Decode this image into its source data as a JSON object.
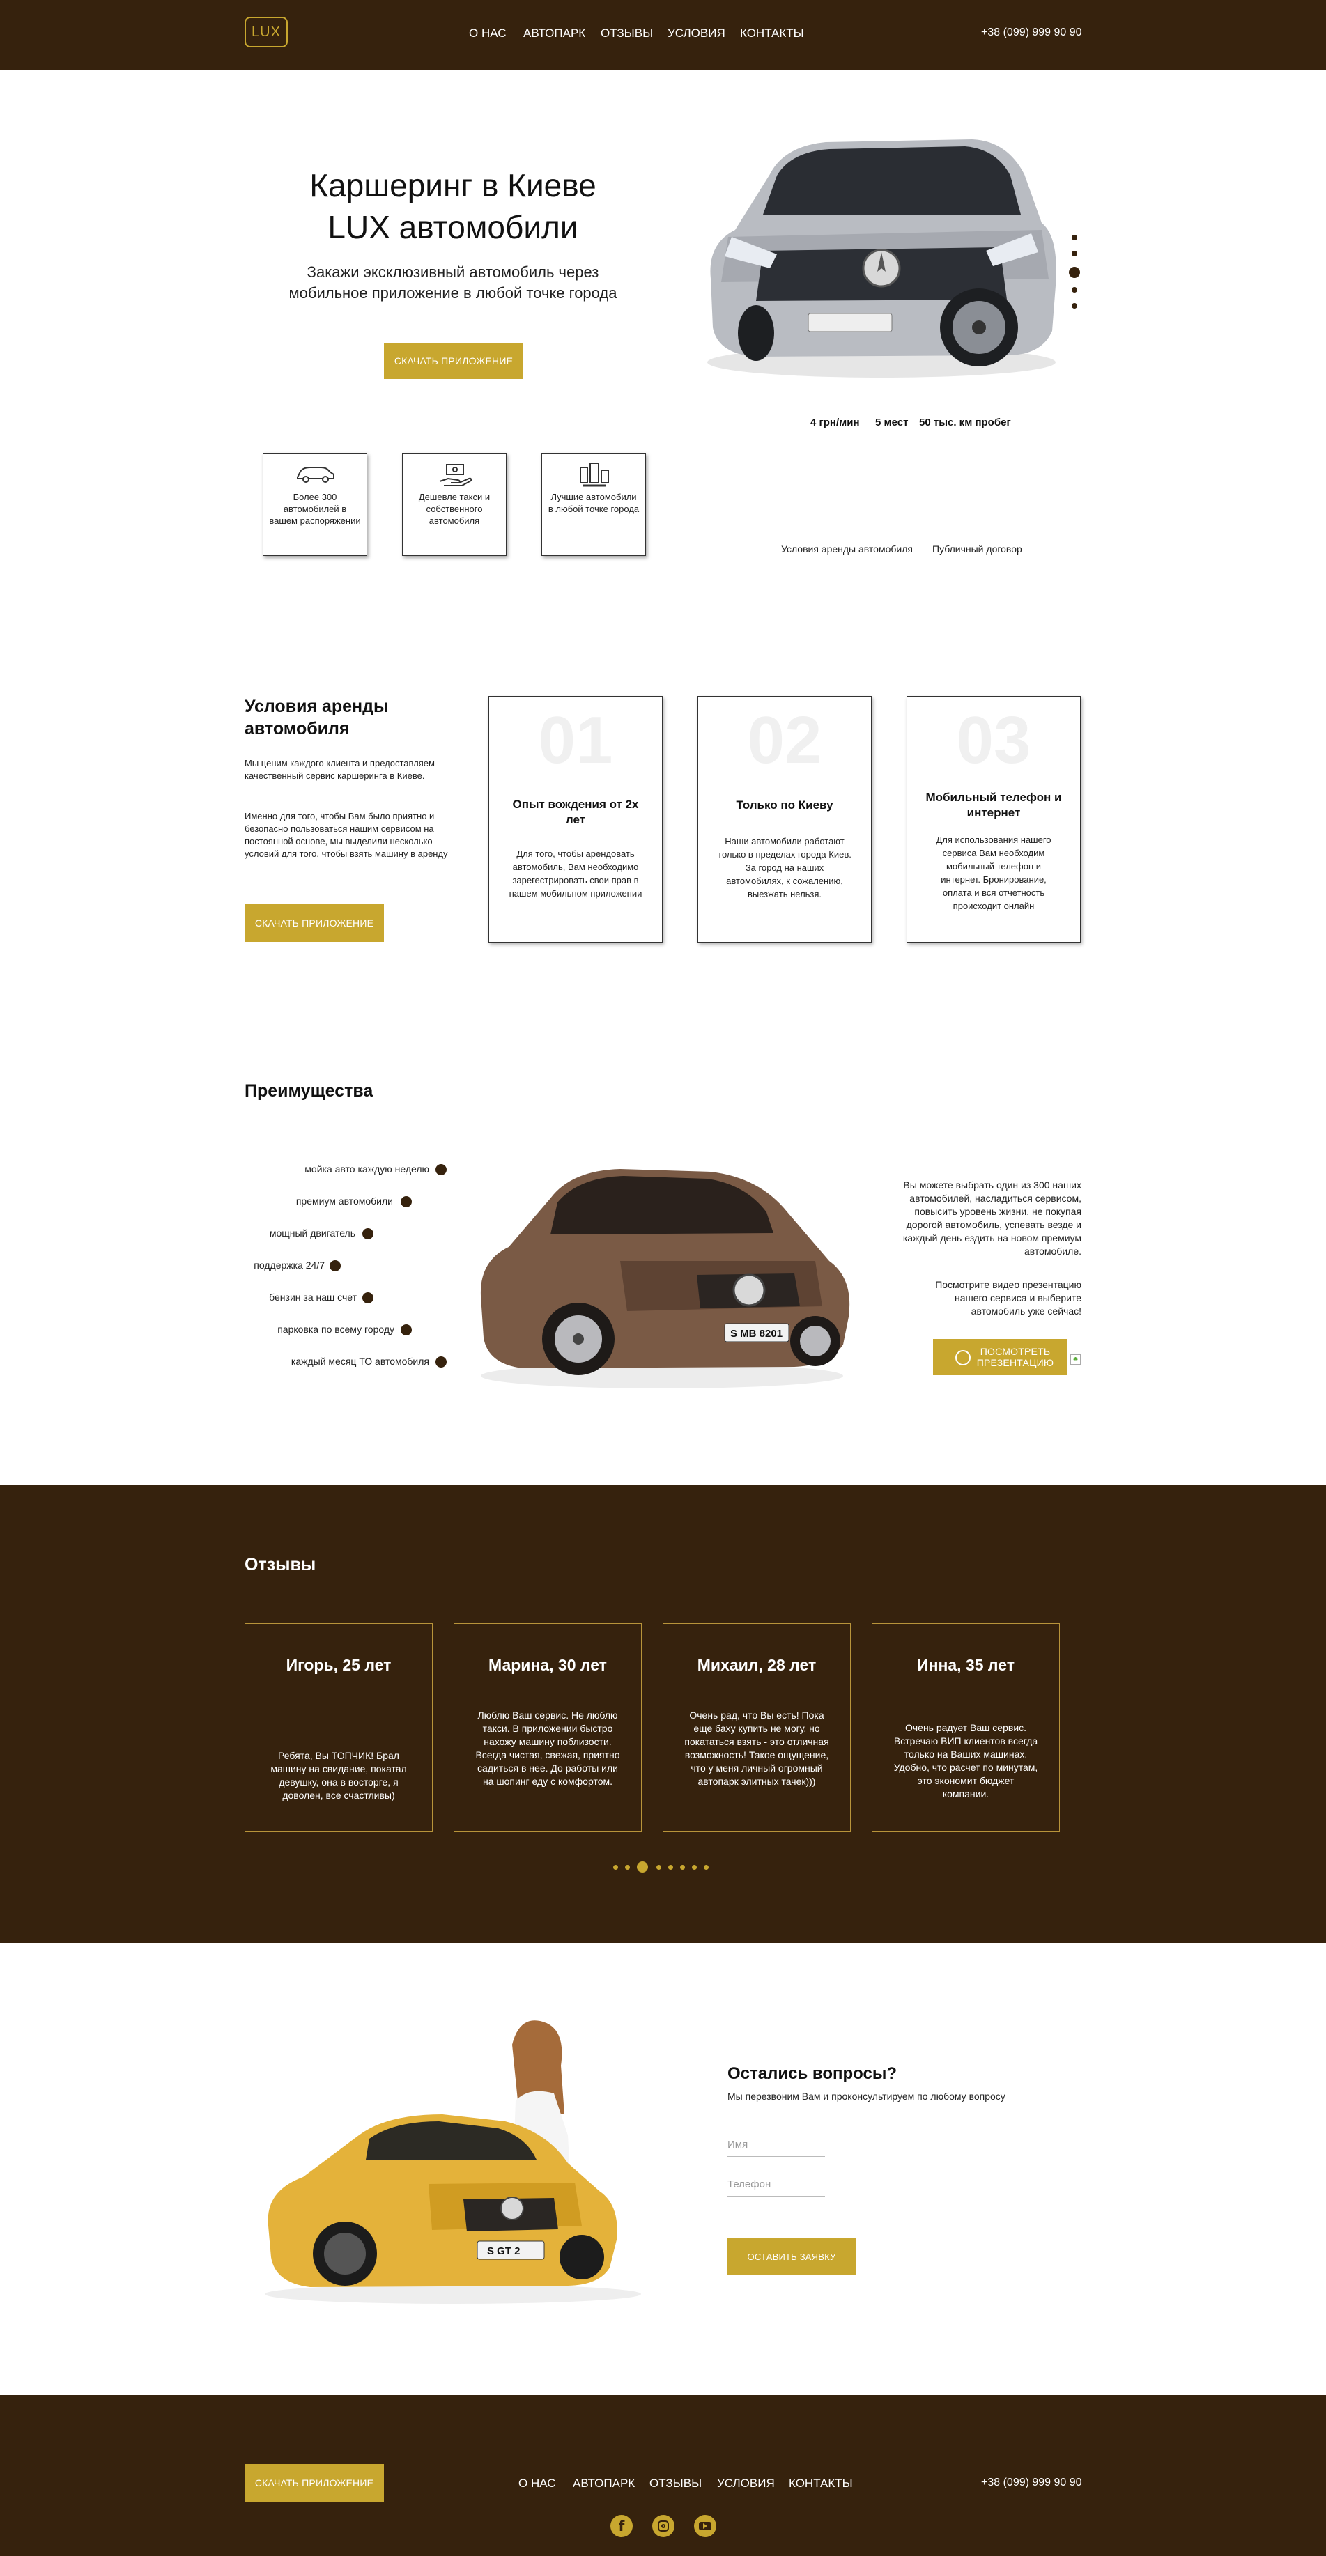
{
  "header": {
    "logo": "LUX",
    "nav": [
      "О НАС",
      "АВТОПАРК",
      "ОТЗЫВЫ",
      "УСЛОВИЯ",
      "КОНТАКТЫ"
    ],
    "phone": "+38 (099) 999 90 90"
  },
  "hero": {
    "title_line1": "Каршеринг в Киеве",
    "title_line2": "LUX автомобили",
    "subtitle_line1": "Закажи эксклюзивный автомобиль через",
    "subtitle_line2": "мобильное приложение в любой точке города",
    "cta": "СКАЧАТЬ ПРИЛОЖЕНИЕ",
    "specs": [
      "4 грн/мин",
      "5 мест",
      "50 тыс. км пробег"
    ],
    "features": [
      "Более 300 автомобилей в вашем распоряжении",
      "Дешевле такси и собственного автомобиля",
      "Лучшие автомобили в любой точке города"
    ],
    "links": [
      "Условия аренды автомобиля",
      "Публичный договор"
    ]
  },
  "conditions": {
    "title_line1": "Условия аренды",
    "title_line2": "автомобиля",
    "para1": "Мы ценим каждого клиента и предоставляем качественный сервис каршеринга в Киеве.",
    "para2": "Именно для того, чтобы Вам было приятно и безопасно пользоваться нашим сервисом на постоянной основе, мы выделили несколько условий для того, чтобы взять машину в аренду",
    "cta": "СКАЧАТЬ ПРИЛОЖЕНИЕ",
    "cards": [
      {
        "num": "01",
        "title": "Опыт вождения от 2х лет",
        "text": "Для того, чтобы арендовать автомобиль, Вам необходимо зарегестрировать свои прав в нашем мобильном приложении"
      },
      {
        "num": "02",
        "title": "Только по Киеву",
        "text": "Наши автомобили работают только в пределах города Киев. За город на наших автомобилях, к сожалению, выезжать нельзя."
      },
      {
        "num": "03",
        "title": "Мобильный телефон и интернет",
        "text": "Для использования нашего сервиса Вам необходим мобильный телефон и интернет. Бронирование, оплата и вся отчетность происходит онлайн"
      }
    ]
  },
  "advantages": {
    "title": "Преимущества",
    "items": [
      "мойка авто каждую неделю",
      "премиум автомобили",
      "мощный двигатель",
      "поддержка 24/7",
      "бензин за наш счет",
      "парковка по всему городу",
      "каждый месяц ТО автомобиля"
    ],
    "right_text1": "Вы можете выбрать один из 300 наших автомобилей, насладиться сервисом, повысить уровень жизни, не покупая дорогой автомобиль, успевать везде и каждый день ездить на новом премиум автомобиле.",
    "right_text2": "Посмотрите видео презентацию нашего сервиса и выберите автомобиль уже сейчас!",
    "video_btn_line1": "ПОСМОТРЕТЬ",
    "video_btn_line2": "ПРЕЗЕНТАЦИЮ",
    "plate": "S MB 8201"
  },
  "reviews": {
    "title": "Отзывы",
    "items": [
      {
        "name": "Игорь, 25 лет",
        "text": "Ребята, Вы ТОПЧИК! Брал машину на свидание, покатал девушку, она в восторге, я доволен, все счастливы)"
      },
      {
        "name": "Марина, 30 лет",
        "text": "Люблю Ваш сервис. Не люблю такси. В приложении быстро нахожу машину поблизости. Всегда чистая, свежая, приятно садиться в нее. До работы или на шопинг еду с комфортом."
      },
      {
        "name": "Михаил, 28 лет",
        "text": "Очень рад, что Вы есть! Пока еще баху купить не могу, но покататься взять - это отличная возможность! Такое ощущение, что у меня личный огромный автопарк элитных тачек)))"
      },
      {
        "name": "Инна, 35 лет",
        "text": "Очень радует Ваш сервис. Встречаю ВИП клиентов всегда только на Ваших машинах. Удобно, что расчет по минутам, это экономит бюджет компании."
      }
    ]
  },
  "contact": {
    "title": "Остались вопросы?",
    "subtitle": "Мы перезвоним Вам и проконсультируем по любому вопросу",
    "name_placeholder": "Имя",
    "phone_placeholder": "Телефон",
    "submit": "ОСТАВИТЬ ЗАЯВКУ",
    "plate": "S GT 2"
  },
  "footer": {
    "cta": "СКАЧАТЬ ПРИЛОЖЕНИЕ",
    "nav": [
      "О НАС",
      "АВТОПАРК",
      "ОТЗЫВЫ",
      "УСЛОВИЯ",
      "КОНТАКТЫ"
    ],
    "phone": "+38 (099) 999 90 90",
    "social": [
      "facebook-icon",
      "instagram-icon",
      "youtube-icon"
    ]
  },
  "colors": {
    "brown": "#36220d",
    "gold": "#c8a72f"
  }
}
